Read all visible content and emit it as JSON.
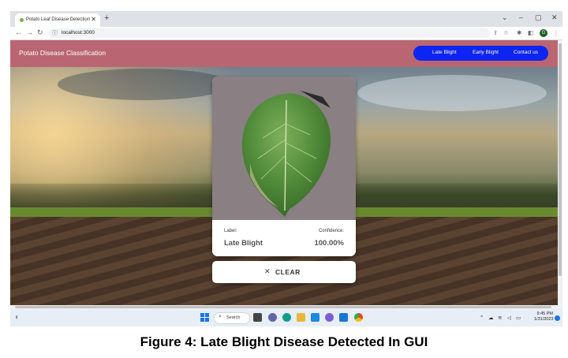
{
  "browser": {
    "tab_title": "Potato Leaf Disease Detection",
    "tab_close": "✕",
    "new_tab": "+",
    "url": "localhost:3000"
  },
  "app": {
    "brand": "Potato Disease Classification",
    "nav": [
      "Late Blight",
      "Early Blight",
      "Contact us"
    ],
    "nav_color": "#0d25f0",
    "appbar_color": "#b96672"
  },
  "result": {
    "label_heading": "Label:",
    "label_value": "Late Blight",
    "confidence_heading": "Confidence:",
    "confidence_value": "100.00%"
  },
  "clear_button": {
    "icon": "✕",
    "label": "CLEAR"
  },
  "taskbar": {
    "search_label": "Search",
    "time": "9:45 PM",
    "date": "1/31/2023"
  },
  "caption": "Figure 4: Late Blight Disease Detected In GUI"
}
